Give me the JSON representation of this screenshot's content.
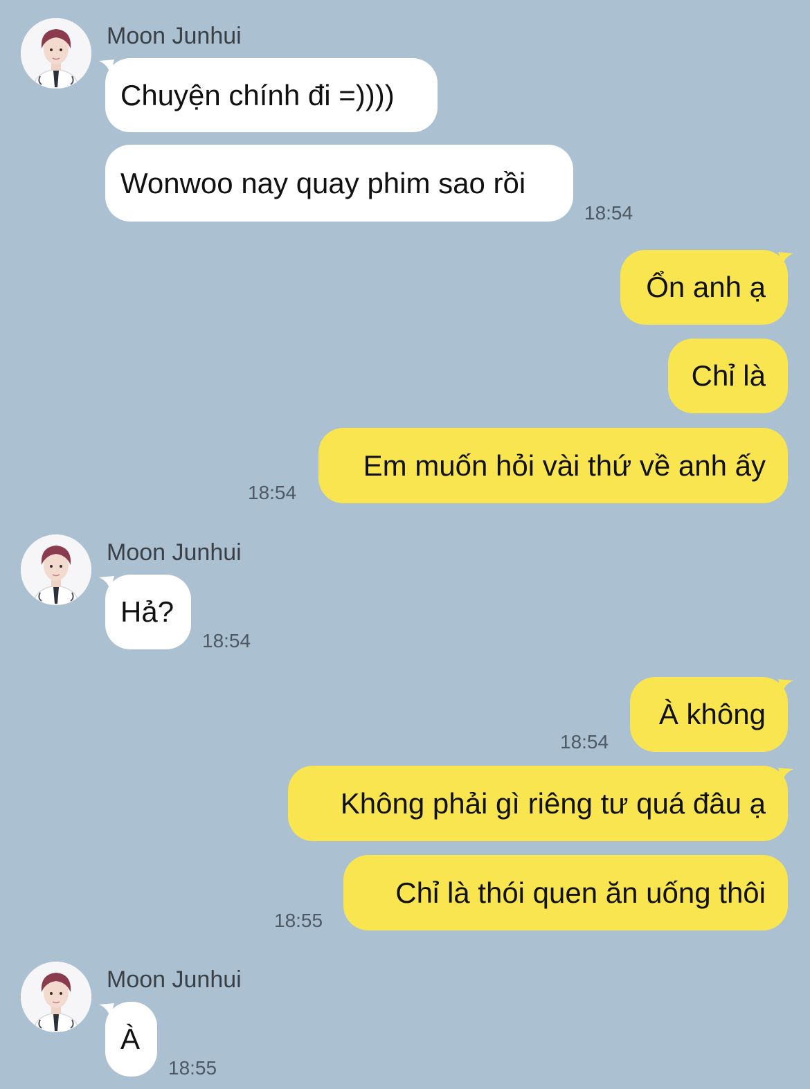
{
  "contact": {
    "name": "Moon Junhui"
  },
  "messages": {
    "m1": "Chuyện chính đi =))))",
    "m2": "Wonwoo nay quay phim sao rồi",
    "m3": "Ổn anh ạ",
    "m4": "Chỉ là",
    "m5": "Em muốn hỏi vài thứ về anh ấy",
    "m6": "Hả?",
    "m7": "À không",
    "m8": "Không phải gì riêng tư quá đâu ạ",
    "m9": "Chỉ là thói quen ăn uống thôi",
    "m10": "À"
  },
  "times": {
    "t1": "18:54",
    "t2": "18:54",
    "t3": "18:54",
    "t4": "18:54",
    "t5": "18:55",
    "t6": "18:55"
  },
  "colors": {
    "background": "#abc1d1",
    "incoming_bubble": "#ffffff",
    "outgoing_bubble": "#f8e550"
  },
  "icons": {
    "avatar": "profile-photo-icon"
  }
}
